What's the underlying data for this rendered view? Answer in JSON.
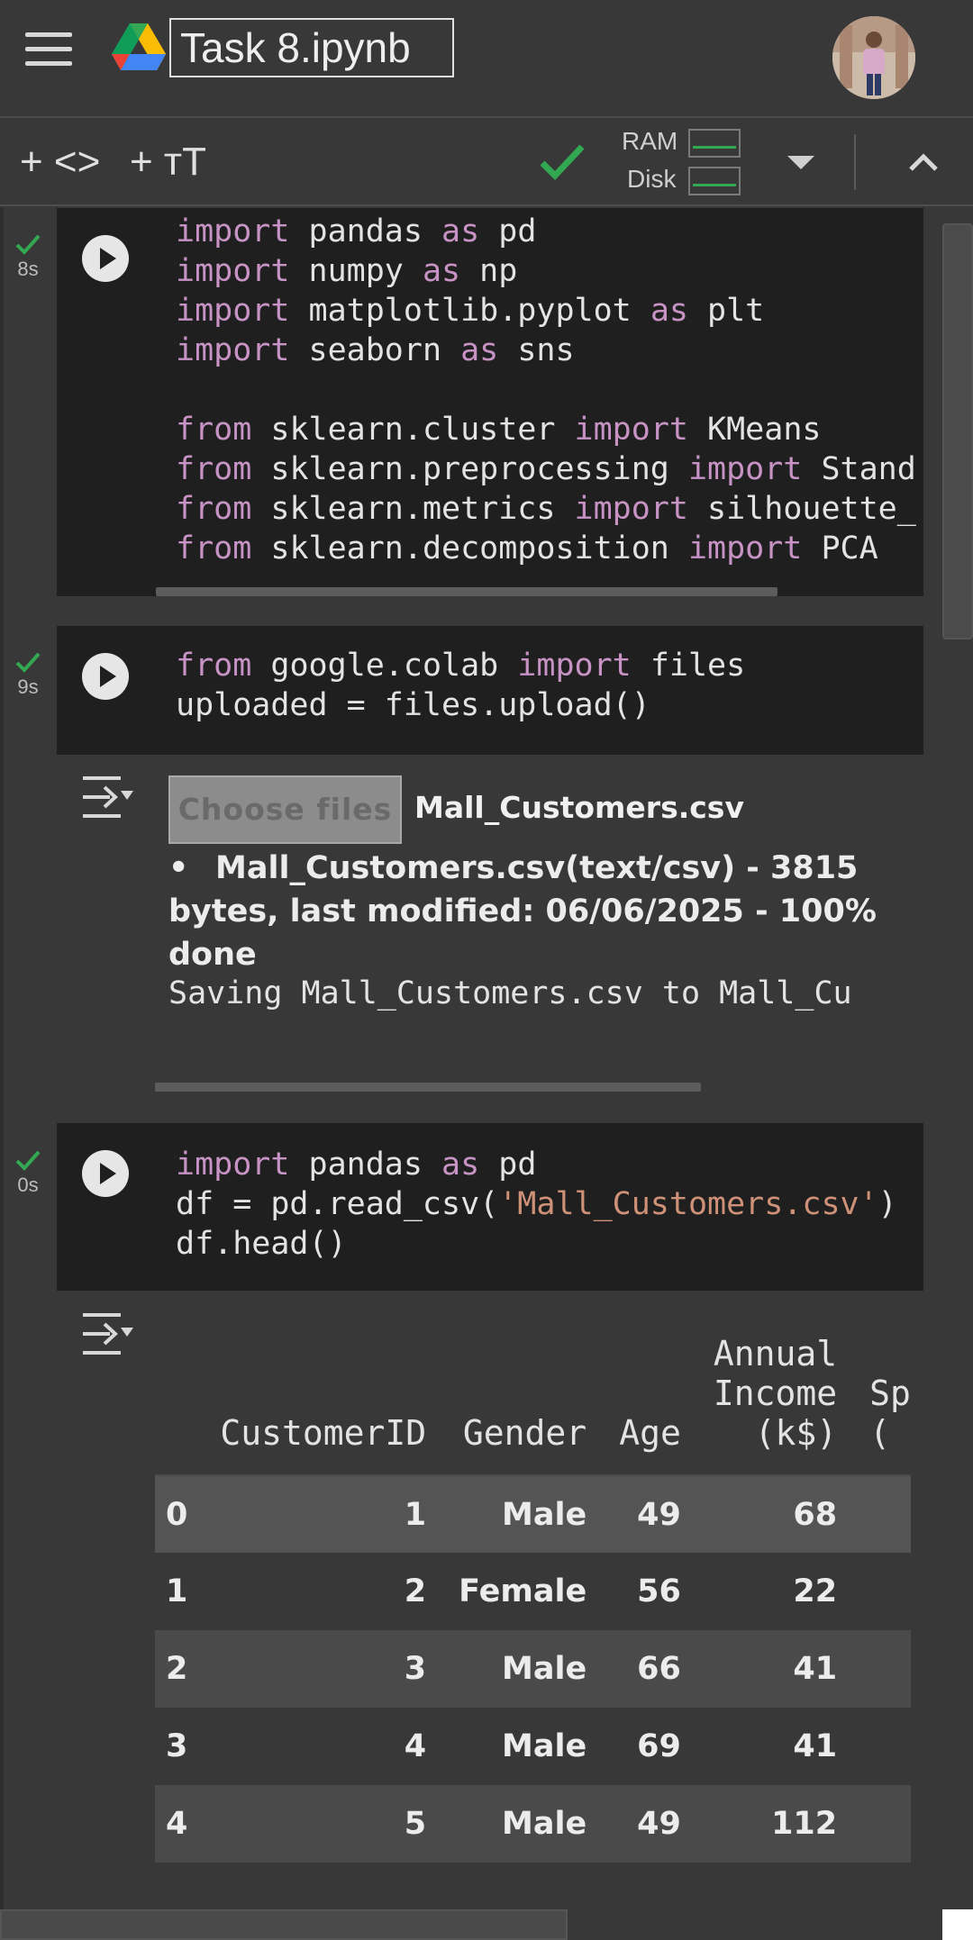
{
  "header": {
    "title": "Task 8.ipynb"
  },
  "toolbar": {
    "add_code_label": "+ <>",
    "add_text_label": "+ тT",
    "ram_label": "RAM",
    "disk_label": "Disk"
  },
  "cells": [
    {
      "time": "8s",
      "lines": [
        [
          [
            "kw",
            "import"
          ],
          [
            "t",
            " pandas "
          ],
          [
            "kw",
            "as"
          ],
          [
            "t",
            " pd"
          ]
        ],
        [
          [
            "kw",
            "import"
          ],
          [
            "t",
            " numpy "
          ],
          [
            "kw",
            "as"
          ],
          [
            "t",
            " np"
          ]
        ],
        [
          [
            "kw",
            "import"
          ],
          [
            "t",
            " matplotlib.pyplot "
          ],
          [
            "kw",
            "as"
          ],
          [
            "t",
            " plt"
          ]
        ],
        [
          [
            "kw",
            "import"
          ],
          [
            "t",
            " seaborn "
          ],
          [
            "kw",
            "as"
          ],
          [
            "t",
            " sns"
          ]
        ],
        [],
        [
          [
            "kw",
            "from"
          ],
          [
            "t",
            " sklearn.cluster "
          ],
          [
            "kw",
            "import"
          ],
          [
            "t",
            " KMeans"
          ]
        ],
        [
          [
            "kw",
            "from"
          ],
          [
            "t",
            " sklearn.preprocessing "
          ],
          [
            "kw",
            "import"
          ],
          [
            "t",
            " Stand"
          ]
        ],
        [
          [
            "kw",
            "from"
          ],
          [
            "t",
            " sklearn.metrics "
          ],
          [
            "kw",
            "import"
          ],
          [
            "t",
            " silhouette_"
          ]
        ],
        [
          [
            "kw",
            "from"
          ],
          [
            "t",
            " sklearn.decomposition "
          ],
          [
            "kw",
            "import"
          ],
          [
            "t",
            " PCA"
          ]
        ]
      ]
    },
    {
      "time": "9s",
      "lines": [
        [
          [
            "kw",
            "from"
          ],
          [
            "t",
            " google.colab "
          ],
          [
            "kw",
            "import"
          ],
          [
            "t",
            " files"
          ]
        ],
        [
          [
            "t",
            "uploaded = files.upload()"
          ]
        ]
      ]
    },
    {
      "time": "0s",
      "lines": [
        [
          [
            "kw",
            "import"
          ],
          [
            "t",
            " pandas "
          ],
          [
            "kw",
            "as"
          ],
          [
            "t",
            " pd"
          ]
        ],
        [
          [
            "t",
            "df = pd.read_csv("
          ],
          [
            "str",
            "'Mall_Customers.csv'"
          ],
          [
            "t",
            ")"
          ]
        ],
        [
          [
            "t",
            "df.head()"
          ]
        ]
      ]
    }
  ],
  "upload_output": {
    "choose_files_label": "Choose files",
    "file_name": "Mall_Customers.csv",
    "bullet": "•",
    "info_text": "Mall_Customers.csv(text/csv) - 3815 bytes, last modified: 06/06/2025 - 100% done",
    "saving_text": "Saving Mall_Customers.csv to Mall_Cu"
  },
  "dataframe": {
    "columns": [
      "",
      "CustomerID",
      "Gender",
      "Age",
      "Annual Income (k$)",
      "Sp ("
    ],
    "rows": [
      [
        "0",
        "1",
        "Male",
        "49",
        "68",
        ""
      ],
      [
        "1",
        "2",
        "Female",
        "56",
        "22",
        ""
      ],
      [
        "2",
        "3",
        "Male",
        "66",
        "41",
        ""
      ],
      [
        "3",
        "4",
        "Male",
        "69",
        "41",
        ""
      ],
      [
        "4",
        "5",
        "Male",
        "49",
        "112",
        ""
      ]
    ]
  },
  "icons": {
    "menu": "hamburger-icon",
    "logo": "google-drive-icon",
    "run": "play-icon",
    "output": "output-toggle-icon",
    "status": "check-icon",
    "collapse": "chevron-up-icon"
  },
  "colors": {
    "keyword": "#c792c4",
    "string": "#ce9178",
    "success": "#33a852"
  }
}
